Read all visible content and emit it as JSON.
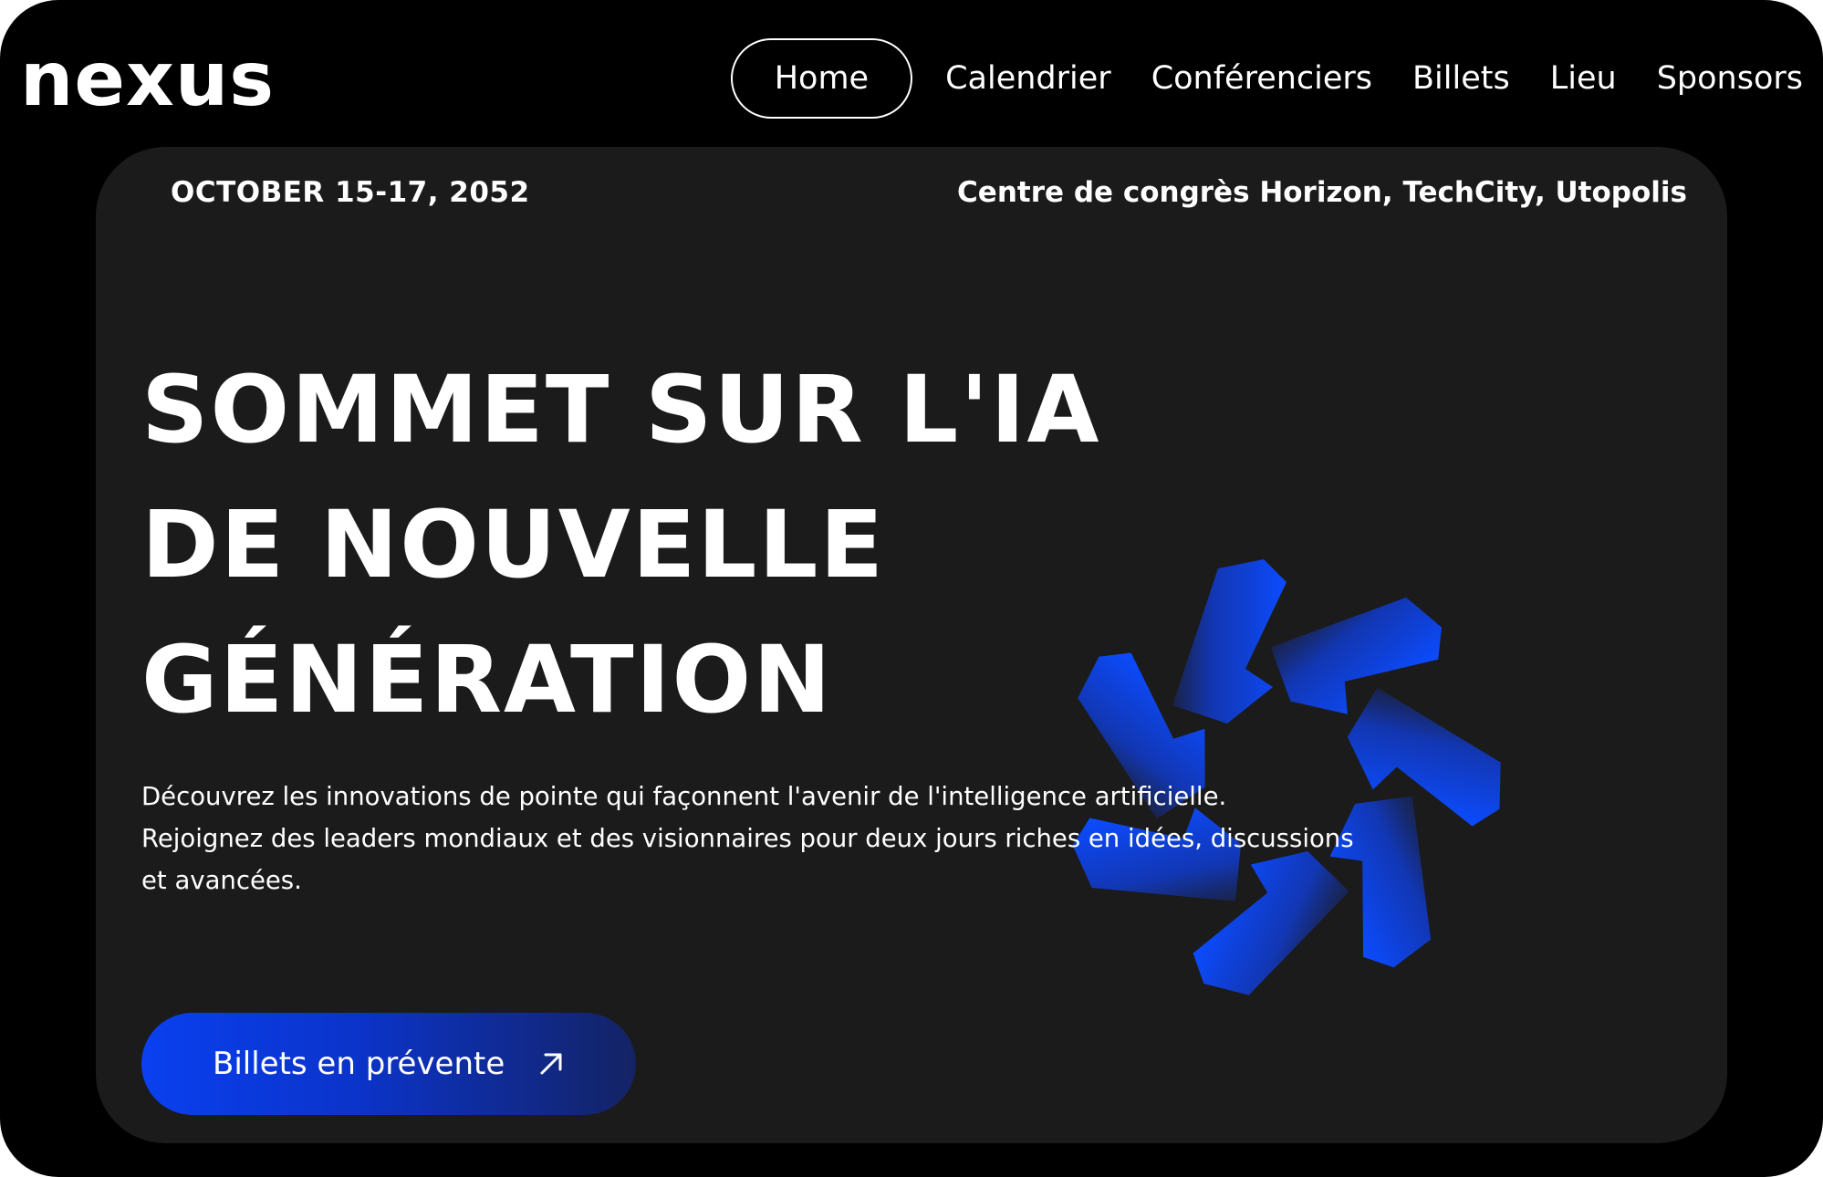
{
  "brand": {
    "logo_text": "nexus"
  },
  "nav": {
    "items": [
      {
        "label": "Home",
        "active": true
      },
      {
        "label": "Calendrier",
        "active": false
      },
      {
        "label": "Conférenciers",
        "active": false
      },
      {
        "label": "Billets",
        "active": false
      },
      {
        "label": "Lieu",
        "active": false
      },
      {
        "label": "Sponsors",
        "active": false
      }
    ]
  },
  "hero": {
    "date": "OCTOBER 15-17, 2052",
    "venue": "Centre de congrès Horizon, TechCity, Utopolis",
    "title_lines": [
      "SOMMET SUR L'IA",
      "DE NOUVELLE",
      "GÉNÉRATION"
    ],
    "description_lines": [
      "Découvrez les innovations de pointe qui façonnent l'avenir de l'intelligence artificielle.",
      "Rejoignez des leaders mondiaux et des visionnaires pour deux jours riches en idées, discussions",
      "et avancées."
    ],
    "cta_label": "Billets en prévente",
    "cta_icon": "arrow-up-right-icon",
    "emblem_icon": "blue-star-emblem-icon"
  },
  "colors": {
    "page_bg": "#000000",
    "card_bg": "#1b1b1b",
    "accent": "#0a40f0",
    "text": "#ffffff"
  }
}
